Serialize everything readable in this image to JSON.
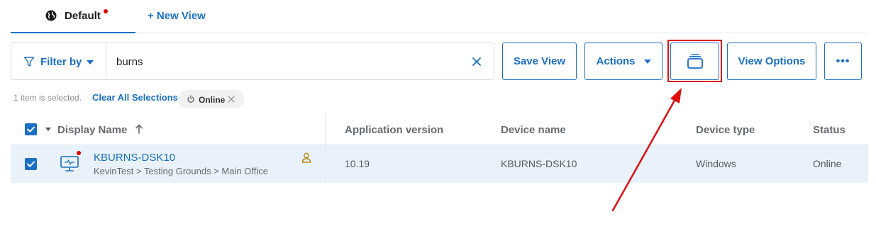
{
  "tabs": {
    "default_label": "Default",
    "new_view_label": "+ New View"
  },
  "filter": {
    "filter_by_label": "Filter by",
    "query": "burns"
  },
  "toolbar": {
    "save_view_label": "Save View",
    "actions_label": "Actions",
    "view_options_label": "View Options",
    "more_label": "•••"
  },
  "selection": {
    "summary": "1 item is selected.",
    "clear_label": "Clear All Selections",
    "chip_label": "Online"
  },
  "table": {
    "headers": {
      "display_name": "Display Name",
      "app_version": "Application version",
      "device_name": "Device name",
      "device_type": "Device type",
      "status": "Status"
    },
    "rows": [
      {
        "display_name": "KBURNS-DSK10",
        "path": "KevinTest > Testing Grounds > Main Office",
        "app_version": "10.19",
        "device_name": "KBURNS-DSK10",
        "device_type": "Windows",
        "status": "Online",
        "selected": true
      }
    ]
  },
  "colors": {
    "accent": "#1a6fc4",
    "alert_dot": "#e00000",
    "annotation": "#e01010",
    "row_selected_bg": "#e9f2fb",
    "user_icon": "#b8860b"
  }
}
